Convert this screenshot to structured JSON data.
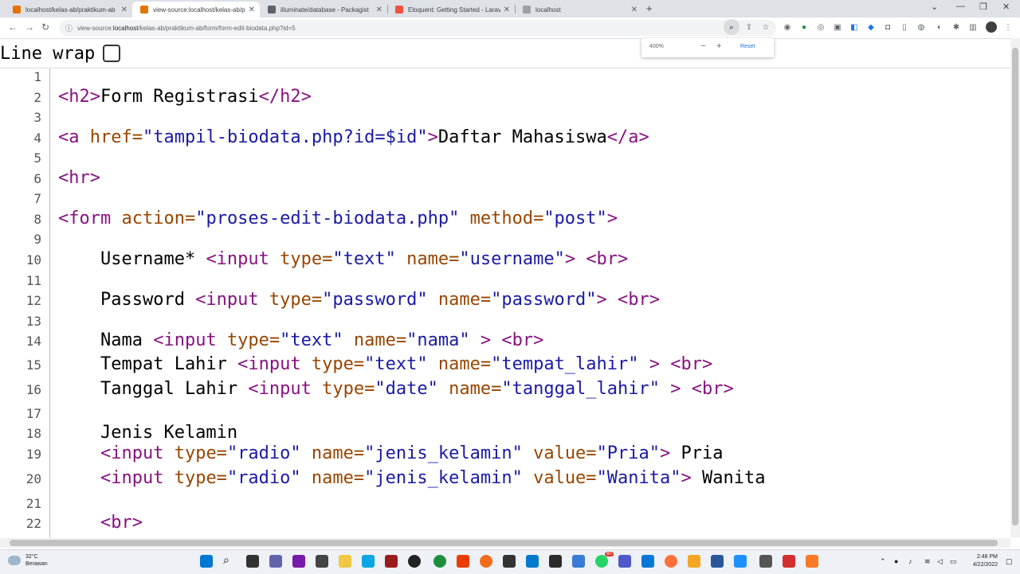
{
  "tabs": [
    {
      "title": "localhost/kelas-ab/praktikum-ab",
      "favicon_color": "#e37400",
      "active": false
    },
    {
      "title": "view-source:localhost/kelas-ab/p",
      "favicon_color": "#e37400",
      "active": true
    },
    {
      "title": "illuminate/database - Packagist",
      "favicon_color": "#5f6368",
      "active": false
    },
    {
      "title": "Eloquent: Getting Started - Larav",
      "favicon_color": "#f05340",
      "active": false
    },
    {
      "title": "localhost",
      "favicon_color": "#9aa0a6",
      "active": false
    }
  ],
  "url": {
    "scheme": "view-source:",
    "host": "localhost",
    "path": "/kelas-ab/praktikum-ab/form/form-edit-biodata.php?id=5"
  },
  "zoom": {
    "level": "400%",
    "reset_label": "Reset"
  },
  "line_wrap": {
    "label": "Line wrap",
    "checked": false
  },
  "source_lines": [
    {
      "n": "1",
      "tokens": []
    },
    {
      "n": "2",
      "tokens": [
        {
          "t": "tag",
          "v": "<h2>"
        },
        {
          "t": "txt",
          "v": "Form Registrasi"
        },
        {
          "t": "tag",
          "v": "</h2>"
        }
      ]
    },
    {
      "n": "3",
      "tokens": []
    },
    {
      "n": "4",
      "tokens": [
        {
          "t": "tag",
          "v": "<a "
        },
        {
          "t": "attr",
          "v": "href="
        },
        {
          "t": "val",
          "v": "\"tampil-biodata.php?id=$id\""
        },
        {
          "t": "tag",
          "v": ">"
        },
        {
          "t": "txt",
          "v": "Daftar Mahasiswa"
        },
        {
          "t": "tag",
          "v": "</a>"
        }
      ]
    },
    {
      "n": "5",
      "tokens": []
    },
    {
      "n": "6",
      "tokens": [
        {
          "t": "tag",
          "v": "<hr>"
        }
      ]
    },
    {
      "n": "7",
      "tokens": []
    },
    {
      "n": "8",
      "tokens": [
        {
          "t": "tag",
          "v": "<form "
        },
        {
          "t": "attr",
          "v": "action="
        },
        {
          "t": "val",
          "v": "\"proses-edit-biodata.php\""
        },
        {
          "t": "tag",
          "v": " "
        },
        {
          "t": "attr",
          "v": "method="
        },
        {
          "t": "val",
          "v": "\"post\""
        },
        {
          "t": "tag",
          "v": ">"
        }
      ]
    },
    {
      "n": "9",
      "tokens": []
    },
    {
      "n": "10",
      "tokens": [
        {
          "t": "txt",
          "v": "    Username* "
        },
        {
          "t": "tag",
          "v": "<input "
        },
        {
          "t": "attr",
          "v": "type="
        },
        {
          "t": "val",
          "v": "\"text\""
        },
        {
          "t": "tag",
          "v": " "
        },
        {
          "t": "attr",
          "v": "name="
        },
        {
          "t": "val",
          "v": "\"username\""
        },
        {
          "t": "tag",
          "v": ">"
        },
        {
          "t": "txt",
          "v": " "
        },
        {
          "t": "tag",
          "v": "<br>"
        }
      ]
    },
    {
      "n": "11",
      "tokens": []
    },
    {
      "n": "12",
      "tokens": [
        {
          "t": "txt",
          "v": "    Password "
        },
        {
          "t": "tag",
          "v": "<input "
        },
        {
          "t": "attr",
          "v": "type="
        },
        {
          "t": "val",
          "v": "\"password\""
        },
        {
          "t": "tag",
          "v": " "
        },
        {
          "t": "attr",
          "v": "name="
        },
        {
          "t": "val",
          "v": "\"password\""
        },
        {
          "t": "tag",
          "v": ">"
        },
        {
          "t": "txt",
          "v": " "
        },
        {
          "t": "tag",
          "v": "<br>"
        }
      ]
    },
    {
      "n": "13",
      "tokens": []
    },
    {
      "n": "14",
      "tokens": [
        {
          "t": "txt",
          "v": "    Nama "
        },
        {
          "t": "tag",
          "v": "<input "
        },
        {
          "t": "attr",
          "v": "type="
        },
        {
          "t": "val",
          "v": "\"text\""
        },
        {
          "t": "tag",
          "v": " "
        },
        {
          "t": "attr",
          "v": "name="
        },
        {
          "t": "val",
          "v": "\"nama\""
        },
        {
          "t": "tag",
          "v": " >"
        },
        {
          "t": "txt",
          "v": " "
        },
        {
          "t": "tag",
          "v": "<br>"
        }
      ]
    },
    {
      "n": "15",
      "tokens": [
        {
          "t": "txt",
          "v": "    Tempat Lahir "
        },
        {
          "t": "tag",
          "v": "<input "
        },
        {
          "t": "attr",
          "v": "type="
        },
        {
          "t": "val",
          "v": "\"text\""
        },
        {
          "t": "tag",
          "v": " "
        },
        {
          "t": "attr",
          "v": "name="
        },
        {
          "t": "val",
          "v": "\"tempat_lahir\""
        },
        {
          "t": "tag",
          "v": " >"
        },
        {
          "t": "txt",
          "v": " "
        },
        {
          "t": "tag",
          "v": "<br>"
        }
      ]
    },
    {
      "n": "16",
      "tokens": [
        {
          "t": "txt",
          "v": "    Tanggal Lahir "
        },
        {
          "t": "tag",
          "v": "<input "
        },
        {
          "t": "attr",
          "v": "type="
        },
        {
          "t": "val",
          "v": "\"date\""
        },
        {
          "t": "tag",
          "v": " "
        },
        {
          "t": "attr",
          "v": "name="
        },
        {
          "t": "val",
          "v": "\"tanggal_lahir\""
        },
        {
          "t": "tag",
          "v": " >"
        },
        {
          "t": "txt",
          "v": " "
        },
        {
          "t": "tag",
          "v": "<br>"
        }
      ]
    },
    {
      "n": "17",
      "tokens": []
    },
    {
      "n": "18",
      "tokens": [
        {
          "t": "txt",
          "v": "    Jenis Kelamin"
        }
      ]
    },
    {
      "n": "19",
      "tokens": [
        {
          "t": "txt",
          "v": "    "
        },
        {
          "t": "tag",
          "v": "<input "
        },
        {
          "t": "attr",
          "v": "type="
        },
        {
          "t": "val",
          "v": "\"radio\""
        },
        {
          "t": "tag",
          "v": " "
        },
        {
          "t": "attr",
          "v": "name="
        },
        {
          "t": "val",
          "v": "\"jenis_kelamin\""
        },
        {
          "t": "tag",
          "v": " "
        },
        {
          "t": "attr",
          "v": "value="
        },
        {
          "t": "val",
          "v": "\"Pria\""
        },
        {
          "t": "tag",
          "v": ">"
        },
        {
          "t": "txt",
          "v": " Pria"
        }
      ]
    },
    {
      "n": "20",
      "tokens": [
        {
          "t": "txt",
          "v": "    "
        },
        {
          "t": "tag",
          "v": "<input "
        },
        {
          "t": "attr",
          "v": "type="
        },
        {
          "t": "val",
          "v": "\"radio\""
        },
        {
          "t": "tag",
          "v": " "
        },
        {
          "t": "attr",
          "v": "name="
        },
        {
          "t": "val",
          "v": "\"jenis_kelamin\""
        },
        {
          "t": "tag",
          "v": " "
        },
        {
          "t": "attr",
          "v": "value="
        },
        {
          "t": "val",
          "v": "\"Wanita\""
        },
        {
          "t": "tag",
          "v": ">"
        },
        {
          "t": "txt",
          "v": " Wanita"
        }
      ]
    },
    {
      "n": "21",
      "tokens": []
    },
    {
      "n": "22",
      "tokens": [
        {
          "t": "txt",
          "v": "    "
        },
        {
          "t": "tag",
          "v": "<br>"
        }
      ]
    }
  ],
  "weather": {
    "temp": "32°C",
    "desc": "Berawan"
  },
  "clock": {
    "time": "2:48 PM",
    "date": "4/22/2022"
  },
  "badge_count": "60"
}
